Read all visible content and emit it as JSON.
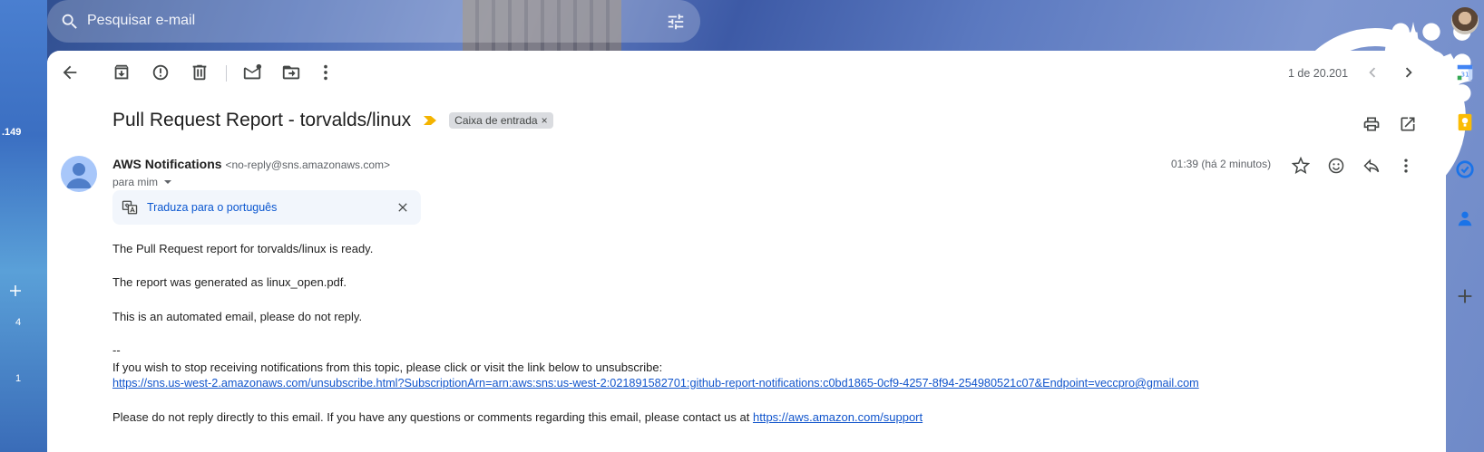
{
  "search": {
    "placeholder": "Pesquisar e-mail"
  },
  "left_rail": {
    "badge": ".149",
    "count_a": "4",
    "count_b": "1"
  },
  "toolbar": {
    "counter": "1 de 20.201"
  },
  "email": {
    "subject": "Pull Request Report - torvalds/linux",
    "label": "Caixa de entrada",
    "label_remove": "×",
    "sender_name": "AWS Notifications",
    "sender_email": "<no-reply@sns.amazonaws.com>",
    "to": "para mim",
    "time": "01:39 (há 2 minutos)",
    "translate_link": "Traduza para o português",
    "body": {
      "line1": "The Pull Request report for torvalds/linux is ready.",
      "line2": "The report was generated as linux_open.pdf.",
      "line3": "This is an automated email, please do not reply.",
      "sig_sep": "--",
      "unsub_text": "If you wish to stop receiving notifications from this topic, please click or visit the link below to unsubscribe:",
      "unsub_link": "https://sns.us-west-2.amazonaws.com/unsubscribe.html?SubscriptionArn=arn:aws:sns:us-west-2:021891582701:github-report-notifications:c0bd1865-0cf9-4257-8f94-254980521c07&Endpoint=veccpro@gmail.com",
      "contact_text": "Please do not reply directly to this email. If you have any questions or comments regarding this email, please contact us at ",
      "contact_link": "https://aws.amazon.com/support"
    }
  },
  "colors": {
    "accent": "#0b57d0",
    "link": "#1155cc",
    "importance": "#f4b400",
    "label_chip": "#dadce0"
  },
  "icons": [
    "search-icon",
    "tune-icon",
    "help-icon",
    "settings-icon",
    "gemini-icon",
    "apps-icon",
    "back-arrow-icon",
    "archive-icon",
    "report-spam-icon",
    "delete-icon",
    "mark-unread-icon",
    "move-to-icon",
    "more-vert-icon",
    "prev-icon",
    "next-icon",
    "importance-icon",
    "print-icon",
    "open-new-window-icon",
    "star-icon",
    "emoji-icon",
    "reply-icon",
    "translate-icon",
    "close-icon",
    "calendar-icon",
    "keep-icon",
    "tasks-icon",
    "contacts-icon",
    "add-icon"
  ]
}
